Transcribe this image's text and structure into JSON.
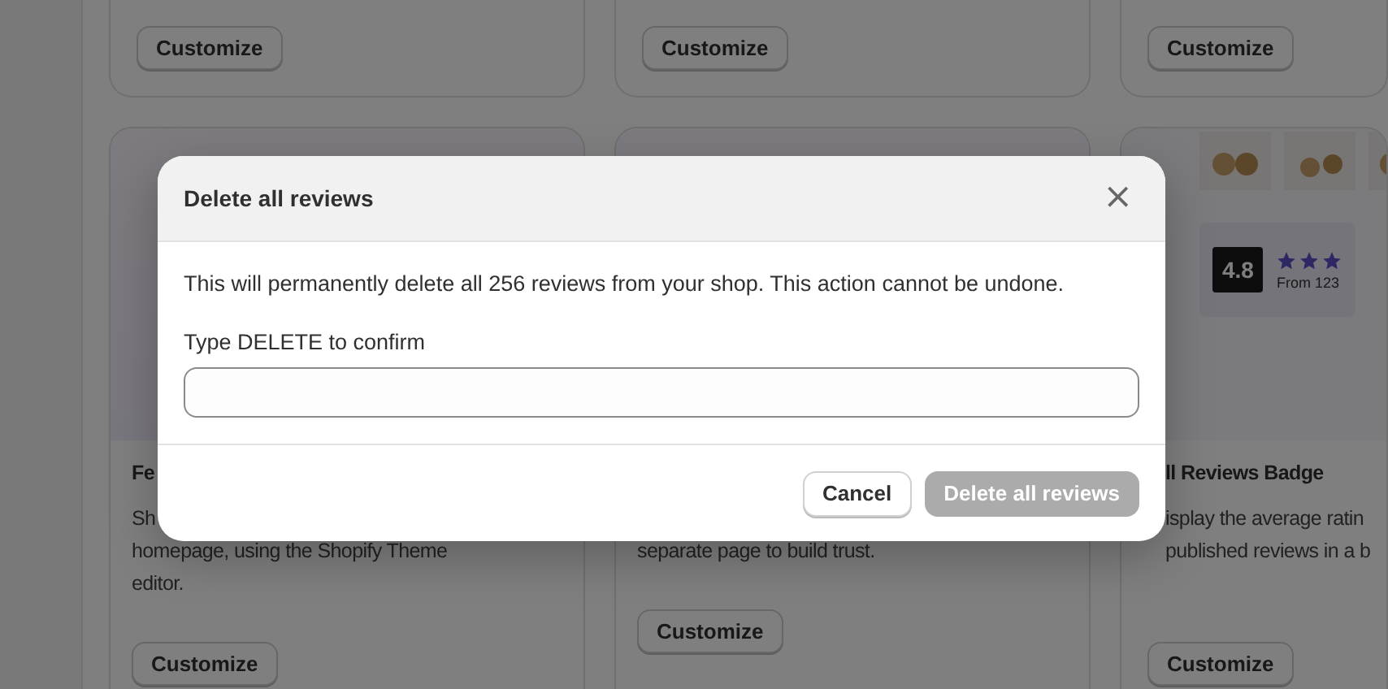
{
  "top_cards": [
    {
      "button": "Customize"
    },
    {
      "button": "Customize"
    },
    {
      "button": "Customize"
    }
  ],
  "cards": [
    {
      "kind": "blank",
      "title": "Fe",
      "lines": [
        "Sh",
        "homepage, using the Shopify Theme",
        "editor."
      ],
      "button": "Customize"
    },
    {
      "kind": "blank",
      "lines_after_hidden": [
        "separate page to build trust."
      ],
      "button": "Customize"
    },
    {
      "kind": "preview",
      "rating": "4.8",
      "rating_caption": "From 123",
      "stars": 3,
      "title": "ll Reviews Badge",
      "lines": [
        "isplay the average ratin",
        "published reviews in a b"
      ],
      "button": "Customize"
    }
  ],
  "dialog": {
    "title": "Delete all reviews",
    "close": "×",
    "message": "This will permanently delete all 256 reviews from your shop. This action cannot be undone.",
    "field_label": "Type DELETE to confirm",
    "cancel": "Cancel",
    "confirm": {
      "label": "Delete all reviews",
      "disabled": true
    }
  }
}
